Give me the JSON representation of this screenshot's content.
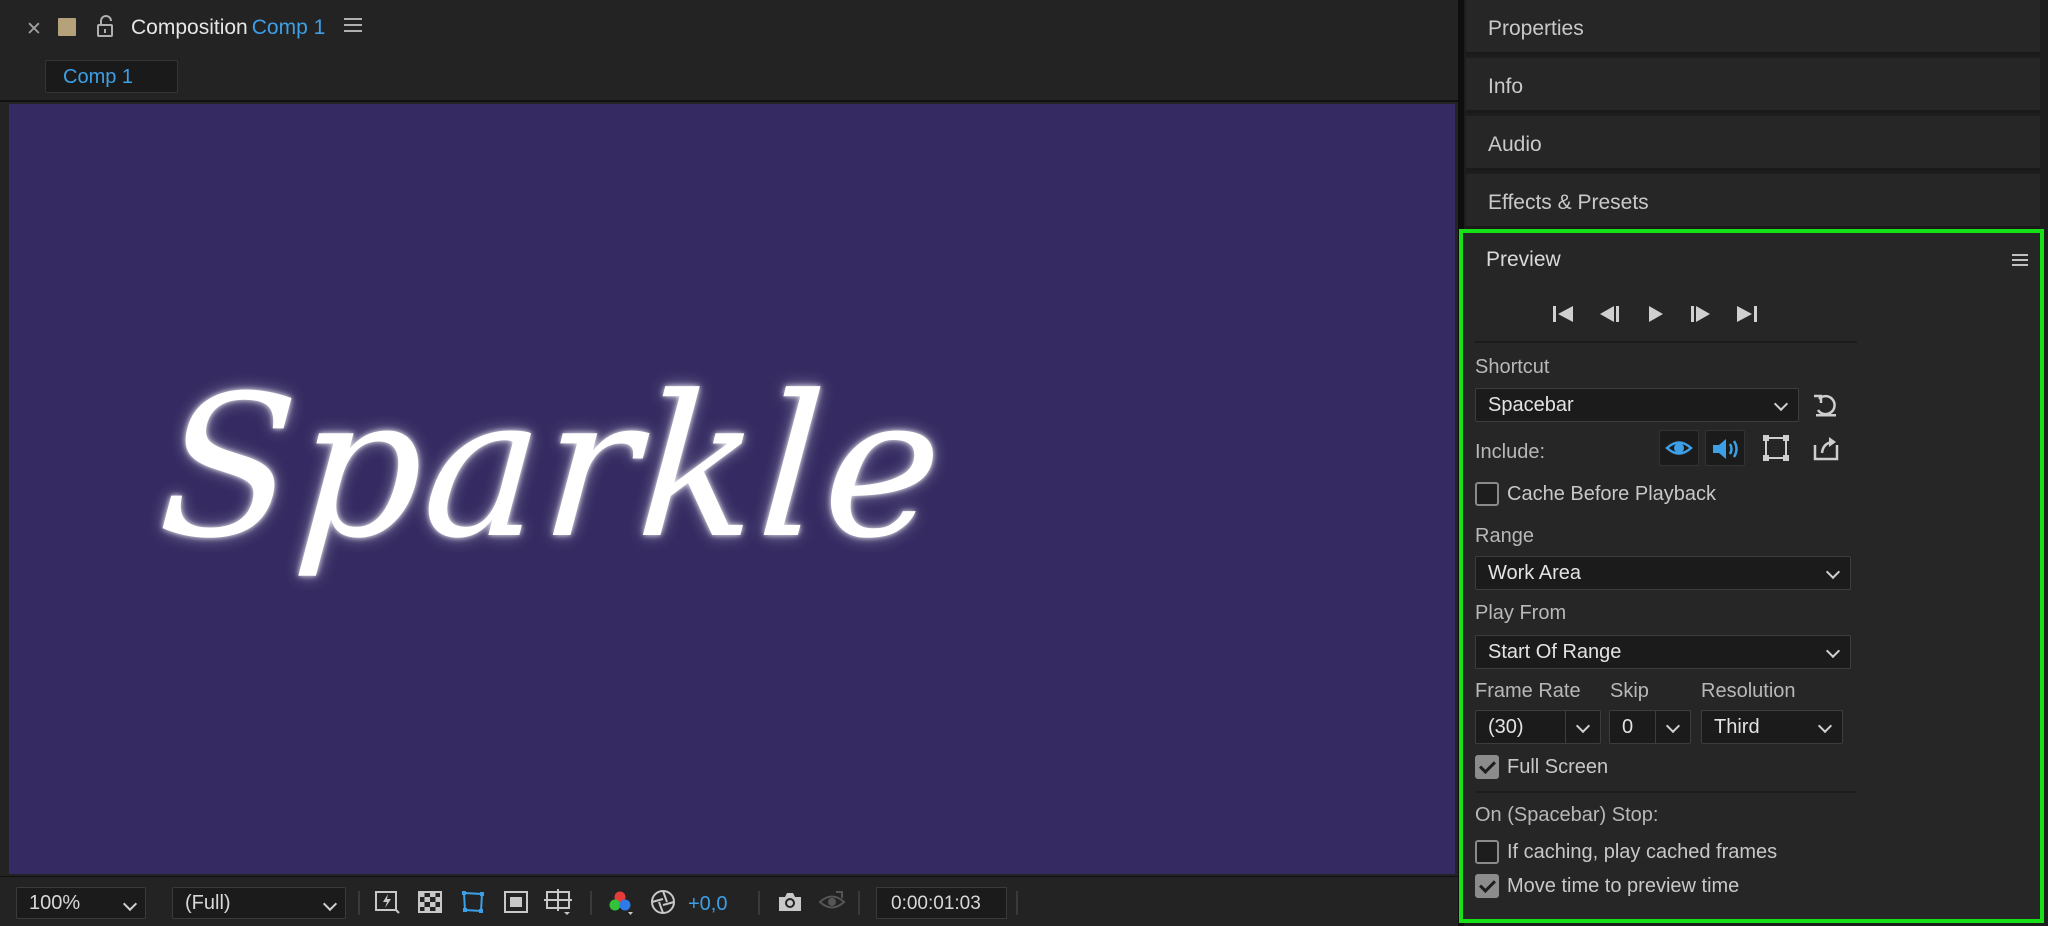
{
  "composition": {
    "tab_prefix": "Composition",
    "comp_name": "Comp 1",
    "comp_chip": "Comp 1",
    "viewer_text": "Sparkle",
    "background_color": "#352b62",
    "accent_color": "#3d9fe6"
  },
  "footer": {
    "zoom": "100%",
    "resolution": "(Full)",
    "exposure": "+0,0",
    "timecode": "0:00:01:03",
    "icons": [
      "fast-previews-icon",
      "transparency-grid-icon",
      "mask-visibility-icon",
      "region-of-interest-icon",
      "guides-grid-icon",
      "color-channels-icon",
      "reset-exposure-icon",
      "snapshot-icon",
      "show-snapshot-icon"
    ]
  },
  "side_panels": [
    "Properties",
    "Info",
    "Audio",
    "Effects & Presets"
  ],
  "preview": {
    "title": "Preview",
    "highlight_color": "#16e016",
    "transport": [
      "first-frame-icon",
      "previous-frame-icon",
      "play-icon",
      "next-frame-icon",
      "last-frame-icon"
    ],
    "shortcut_label": "Shortcut",
    "shortcut_value": "Spacebar",
    "include_label": "Include:",
    "cache_before_playback": "Cache Before Playback",
    "range_label": "Range",
    "range_value": "Work Area",
    "play_from_label": "Play From",
    "play_from_value": "Start Of Range",
    "frame_rate_label": "Frame Rate",
    "frame_rate_value": "(30)",
    "skip_label": "Skip",
    "skip_value": "0",
    "resolution_label": "Resolution",
    "resolution_value": "Third",
    "full_screen": "Full Screen",
    "stop_label": "On (Spacebar) Stop:",
    "if_caching": "If caching, play cached frames",
    "move_time": "Move time to preview time",
    "checks": {
      "cache_before_playback": false,
      "full_screen": true,
      "if_caching": false,
      "move_time": true
    }
  }
}
